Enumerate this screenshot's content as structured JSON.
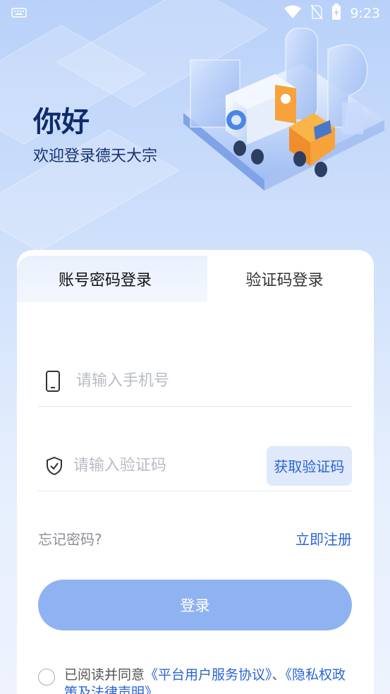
{
  "status_bar": {
    "time": "9:23",
    "icons": [
      "keyboard-icon",
      "wifi-icon",
      "no-sim-icon",
      "battery-charging-icon"
    ]
  },
  "header": {
    "greeting": "你好",
    "subtitle": "欢迎登录德天大宗",
    "illustration": "logistics-truck-illustration"
  },
  "tabs": [
    {
      "label": "账号密码登录",
      "active": false
    },
    {
      "label": "验证码登录",
      "active": true
    }
  ],
  "form": {
    "phone_placeholder": "请输入手机号",
    "phone_value": "",
    "phone_icon": "phone-icon",
    "code_placeholder": "请输入验证码",
    "code_value": "",
    "code_icon": "shield-check-icon",
    "get_code_label": "获取验证码"
  },
  "links": {
    "forgot_password": "忘记密码?",
    "register": "立即注册"
  },
  "login_button_label": "登录",
  "agreement": {
    "prefix": "已阅读并同意",
    "user_agreement": "《平台用户服务协议》",
    "separator": "、",
    "privacy_policy": "《隐私权政策及法律声明》",
    "checked": false
  },
  "colors": {
    "accent": "#2b64d6",
    "login_button": "#8fb3f1",
    "title": "#0f2b6b"
  }
}
